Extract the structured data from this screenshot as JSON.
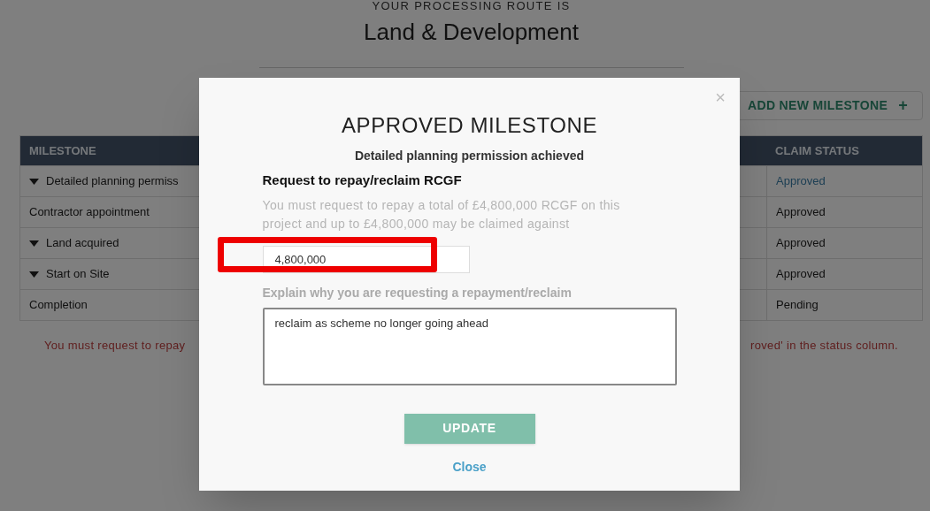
{
  "page": {
    "route_label": "YOUR PROCESSING ROUTE IS",
    "route": "Land & Development",
    "add_button": "ADD NEW MILESTONE",
    "add_icon": "+"
  },
  "table": {
    "columns": [
      "MILESTONE",
      "CLAIM STATUS"
    ],
    "rows": [
      {
        "kind": "group",
        "milestone": "Detailed planning permiss",
        "status": "Approved",
        "link": true
      },
      {
        "kind": "item",
        "milestone": "Contractor appointment",
        "status": "Approved",
        "link": false
      },
      {
        "kind": "group",
        "milestone": "Land acquired",
        "status": "Approved",
        "link": false
      },
      {
        "kind": "group",
        "milestone": "Start on Site",
        "status": "Approved",
        "link": false
      },
      {
        "kind": "item",
        "milestone": "Completion",
        "status": "Pending",
        "link": false
      }
    ]
  },
  "footer_note_left": "You must request to repay",
  "footer_note_right": "roved' in the status column.",
  "modal": {
    "title": "APPROVED MILESTONE",
    "subtitle": "Detailed planning permission achieved",
    "section": "Request to repay/reclaim RCGF",
    "info": "You must request to repay a total of £4,800,000 RCGF on this project and up to £4,800,000 may be claimed against",
    "amount": "4,800,000",
    "amount_highlighted": true,
    "reason_label": "Explain why you are requesting a repayment/reclaim",
    "reason": "reclaim as scheme no longer going ahead",
    "update_button": "UPDATE",
    "close_link": "Close",
    "close_icon": "×"
  }
}
